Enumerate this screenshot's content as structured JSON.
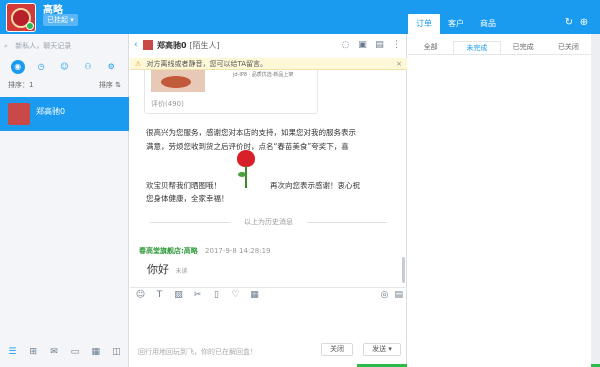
{
  "account": {
    "name": "高略",
    "status_label": "已挂起",
    "status_arrow": "▾"
  },
  "right_tabs": [
    {
      "label": "订单"
    },
    {
      "label": "客户"
    },
    {
      "label": "商品"
    }
  ],
  "top_icons": {
    "refresh": "↻",
    "add": "⊕"
  },
  "left": {
    "search_placeholder": "新私人，聊天记录",
    "sort_left": "排序：1",
    "sort_right": "排序 ⇅",
    "contact_name": "郑高驰0"
  },
  "chat": {
    "header_name": "郑高驰0",
    "header_tag": "[陌生人]",
    "notice": "对方离线或者静音，您可以给TA留言。",
    "card_text": "jd-IP8 · 品质优选·新品上架",
    "reviews": "评价(490)",
    "msg1_line1": "很高兴为您服务，感谢您对本店的支持，如果您对我的服务表示",
    "msg1_line2": "满意，劳烦您收到货之后评价时，点名“春苗美食”夸奖下，喜",
    "msg2_left1": "欢宝贝帮我们晒图哦！",
    "msg2_right1": "再次向您表示感谢！衷心祝",
    "msg2_left2": "您身体健康，全家幸福！",
    "history_label": "以上为历史消息",
    "sender_name": "春高堂旗舰店:高略",
    "sender_time": "2017-9-8 14:28:19",
    "reply_text": "你好",
    "reply_status": "未读",
    "input_hint": "回行用地回玩到飞，你的已在解回盒！",
    "close_label": "关闭",
    "send_label": "发送",
    "send_arrow": "▾"
  },
  "orders": {
    "tabs": [
      {
        "label": "全部"
      },
      {
        "label": "未完成"
      },
      {
        "label": "已完成"
      },
      {
        "label": "已关闭"
      }
    ],
    "active_tab": 1
  },
  "colors": {
    "accent": "#1a9bf0",
    "sender_green": "#2f9a3a",
    "notice_bg": "#fff8d8"
  }
}
